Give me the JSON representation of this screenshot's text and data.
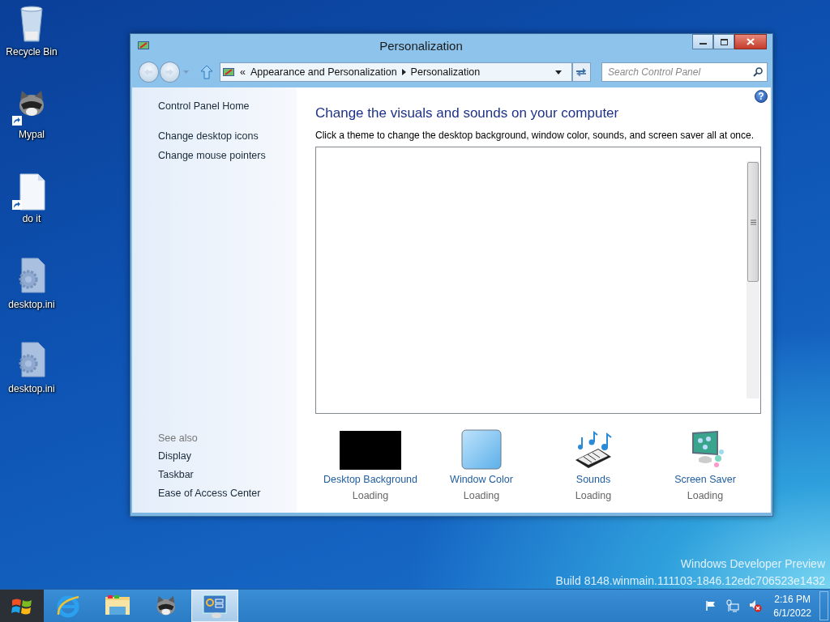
{
  "desktop_icons": [
    {
      "label": "Recycle Bin",
      "kind": "recycle"
    },
    {
      "label": "Mypal",
      "kind": "raccoon",
      "shortcut": true
    },
    {
      "label": "do it",
      "kind": "file",
      "shortcut": true
    },
    {
      "label": "desktop.ini",
      "kind": "settings-file"
    },
    {
      "label": "desktop.ini",
      "kind": "settings-file"
    }
  ],
  "window": {
    "title": "Personalization",
    "address": {
      "overflow": "«",
      "crumbs": [
        "Appearance and Personalization",
        "Personalization"
      ]
    },
    "search": {
      "placeholder": "Search Control Panel"
    },
    "sidebar": {
      "links": [
        "Control Panel Home",
        "Change desktop icons",
        "Change mouse pointers"
      ],
      "see_also_heading": "See also",
      "see_also": [
        "Display",
        "Taskbar",
        "Ease of Access Center"
      ]
    },
    "help": "?",
    "heading": "Change the visuals and sounds on your computer",
    "description": "Click a theme to change the desktop background, window color, sounds, and screen saver all at once.",
    "settings": [
      {
        "label": "Desktop Background",
        "status": "Loading",
        "kind": "background"
      },
      {
        "label": "Window Color",
        "status": "Loading",
        "kind": "color"
      },
      {
        "label": "Sounds",
        "status": "Loading",
        "kind": "sounds"
      },
      {
        "label": "Screen Saver",
        "status": "Loading",
        "kind": "screensaver"
      }
    ]
  },
  "watermark": [
    "Windows Developer Preview",
    "Build 8148.winmain.111103-1846.12edc706523e1432"
  ],
  "taskbar": {
    "apps": [
      {
        "kind": "browser",
        "selected": false
      },
      {
        "kind": "folder",
        "selected": false
      },
      {
        "kind": "raccoon",
        "selected": false
      },
      {
        "kind": "control-panel",
        "selected": true
      }
    ],
    "clock": {
      "time": "2:16 PM",
      "date": "6/1/2022"
    }
  }
}
